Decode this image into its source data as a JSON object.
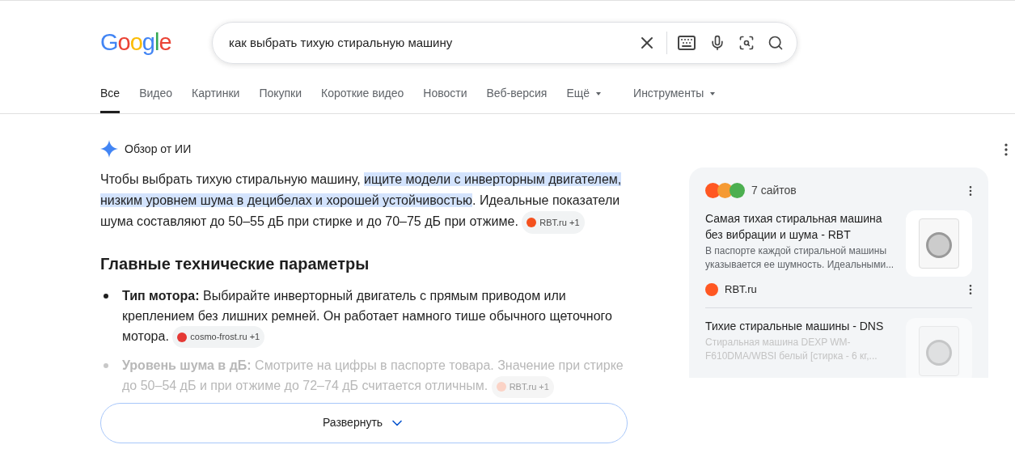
{
  "logo": "Google",
  "search": {
    "value": "как выбрать тихую стиральную машину"
  },
  "tabs": [
    {
      "label": "Все",
      "selected": true,
      "dropdown": false
    },
    {
      "label": "Видео",
      "selected": false,
      "dropdown": false
    },
    {
      "label": "Картинки",
      "selected": false,
      "dropdown": false
    },
    {
      "label": "Покупки",
      "selected": false,
      "dropdown": false
    },
    {
      "label": "Короткие видео",
      "selected": false,
      "dropdown": false
    },
    {
      "label": "Новости",
      "selected": false,
      "dropdown": false
    },
    {
      "label": "Веб-версия",
      "selected": false,
      "dropdown": false
    },
    {
      "label": "Ещё",
      "selected": false,
      "dropdown": true
    },
    {
      "label": "Инструменты",
      "selected": false,
      "dropdown": true
    }
  ],
  "overview": {
    "title": "Обзор от ИИ",
    "intro": [
      {
        "text": "Чтобы выбрать тихую стиральную машину, ",
        "highlighted": false
      },
      {
        "text": "ищите модели с инверторным двигателем, низким уровнем шума в децибелах и хорошей устойчивостью",
        "highlighted": true
      },
      {
        "text": ". Идеальные показатели шума составляют до 50–55 дБ при стирке и до 70–75 дБ при отжиме.",
        "highlighted": false
      }
    ],
    "intro_chip": {
      "label": "RBT.ru +1",
      "color": "#f4511e"
    },
    "heading": "Главные технические параметры",
    "bullets": [
      {
        "text": "**Тип мотора:** Выбирайте инверторный двигатель с прямым приводом или креплением без лишних ремней. Он работает намного тише обычного щеточного мотора.",
        "chip": {
          "label": "cosmo-frost.ru +1",
          "color": "#e53935"
        },
        "faded": false
      },
      {
        "text": "**Уровень шума в дБ:** Смотрите на цифры в паспорте товара. Значение при стирке до 50–54 дБ и при отжиме до 72–74 дБ считается отличным.",
        "chip": {
          "label": "RBT.ru +1",
          "color": "#fbd3c6"
        },
        "faded": true
      }
    ],
    "expand_button": "Развернуть"
  },
  "sources": {
    "count": "7 сайтов",
    "items": [
      {
        "title": "Самая тихая стиральная машина без вибрации и шума - RBT",
        "snippet": "В паспорте каждой стиральной машины указывается ее шумность. Идеальными...",
        "site": "RBT.ru",
        "faded": false
      },
      {
        "title": "Тихие стиральные машины - DNS",
        "snippet": "Стиральная машина DEXP WM-F610DMA/WBSI белый [стирка - 6 кг,...",
        "faded": true
      }
    ]
  }
}
